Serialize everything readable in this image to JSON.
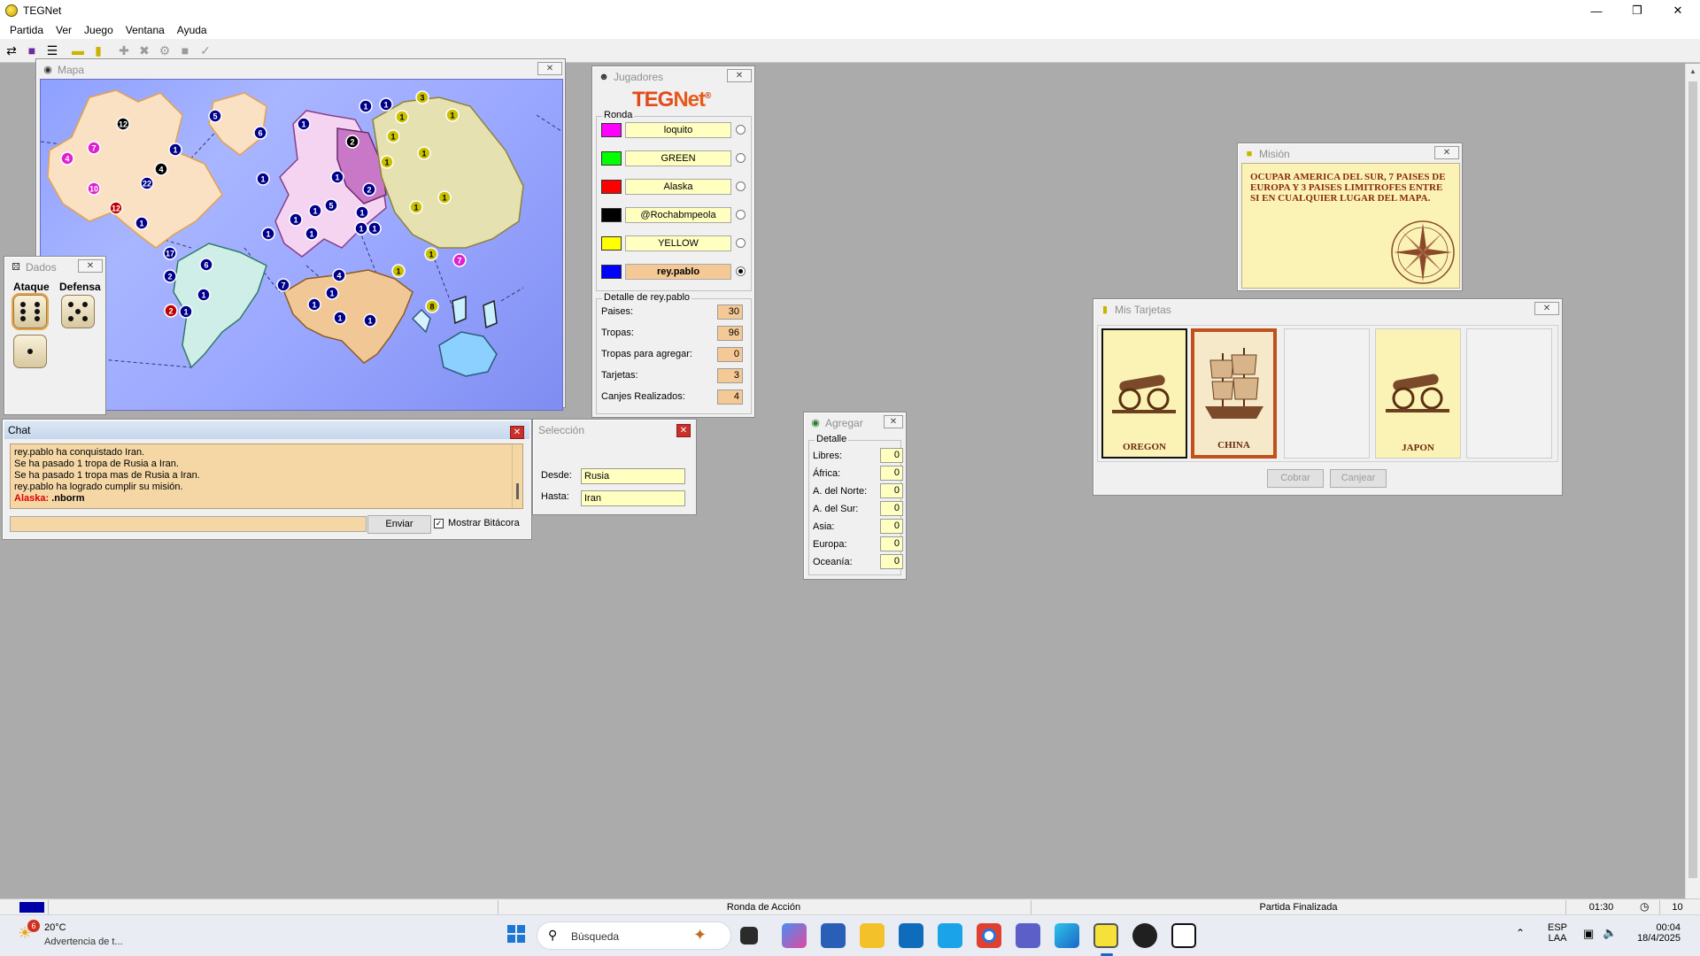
{
  "app": {
    "title": "TEGNet"
  },
  "menu": [
    "Partida",
    "Ver",
    "Juego",
    "Ventana",
    "Ayuda"
  ],
  "windows": {
    "map": {
      "title": "Mapa"
    },
    "dados": {
      "title": "Dados",
      "attack_label": "Ataque",
      "defense_label": "Defensa",
      "attack_dice": [
        6,
        1
      ],
      "defense_dice": [
        5
      ]
    },
    "jugadores": {
      "title": "Jugadores",
      "logo_teg": "TEG",
      "logo_net": "Net",
      "logo_mark": "®",
      "round_label": "Ronda",
      "players": [
        {
          "name": "loquito",
          "color": "#ff00ff"
        },
        {
          "name": "GREEN",
          "color": "#00ff00"
        },
        {
          "name": "Alaska",
          "color": "#ff0000"
        },
        {
          "name": "@Rochabmpeola",
          "color": "#000000"
        },
        {
          "name": "YELLOW",
          "color": "#ffff00"
        },
        {
          "name": "rey.pablo",
          "color": "#0000ff",
          "current": true
        }
      ],
      "detail_label": "Detalle de rey.pablo",
      "details": [
        {
          "label": "Paises:",
          "value": "30"
        },
        {
          "label": "Tropas:",
          "value": "96"
        },
        {
          "label": "Tropas para agregar:",
          "value": "0"
        },
        {
          "label": "Tarjetas:",
          "value": "3"
        },
        {
          "label": "Canjes Realizados:",
          "value": "4"
        }
      ]
    },
    "chat": {
      "title": "Chat",
      "lines": [
        "rey.pablo ha conquistado Iran.",
        "Se ha pasado 1 tropa de Rusia a Iran.",
        "Se ha pasado 1 tropa mas de Rusia a Iran.",
        "rey.pablo ha logrado cumplir su misión."
      ],
      "last_user": "Alaska:",
      "last_msg": ".nborm",
      "input_value": "",
      "send_label": "Enviar",
      "log_checkbox_label": "Mostrar Bitácora"
    },
    "seleccion": {
      "title": "Selección",
      "from_label": "Desde:",
      "from_value": "Rusia",
      "to_label": "Hasta:",
      "to_value": "Iran"
    },
    "agregar": {
      "title": "Agregar",
      "detail_label": "Detalle",
      "rows": [
        {
          "label": "Libres:",
          "value": "0"
        },
        {
          "label": "África:",
          "value": "0"
        },
        {
          "label": "A. del Norte:",
          "value": "0"
        },
        {
          "label": "A. del Sur:",
          "value": "0"
        },
        {
          "label": "Asia:",
          "value": "0"
        },
        {
          "label": "Europa:",
          "value": "0"
        },
        {
          "label": "Oceanía:",
          "value": "0"
        }
      ]
    },
    "mision": {
      "title": "Misión",
      "text": "OCUPAR AMERICA DEL SUR, 7 PAISES DE EUROPA Y 3 PAISES LIMITROFES ENTRE SI EN CUALQUIER LUGAR DEL MAPA."
    },
    "tarjetas": {
      "title": "Mis Tarjetas",
      "cards": [
        {
          "name": "OREGON",
          "symbol": "cannon-icon"
        },
        {
          "name": "CHINA",
          "symbol": "ship-icon",
          "selected": true
        },
        {
          "name": "",
          "symbol": ""
        },
        {
          "name": "JAPON",
          "symbol": "cannon-icon"
        },
        {
          "name": "",
          "symbol": ""
        }
      ],
      "collect_label": "Cobrar",
      "exchange_label": "Canjear"
    }
  },
  "status": {
    "phase": "Ronda de Acción",
    "game": "Partida Finalizada",
    "time": "01:30",
    "count": "10"
  },
  "taskbar": {
    "weather_badge": "6",
    "weather_temp": "20°C",
    "weather_desc": "Advertencia de t...",
    "search_placeholder": "Búsqueda",
    "lang_top": "ESP",
    "lang_bottom": "LAA",
    "clock_time": "00:04",
    "clock_date": "18/4/2025"
  }
}
